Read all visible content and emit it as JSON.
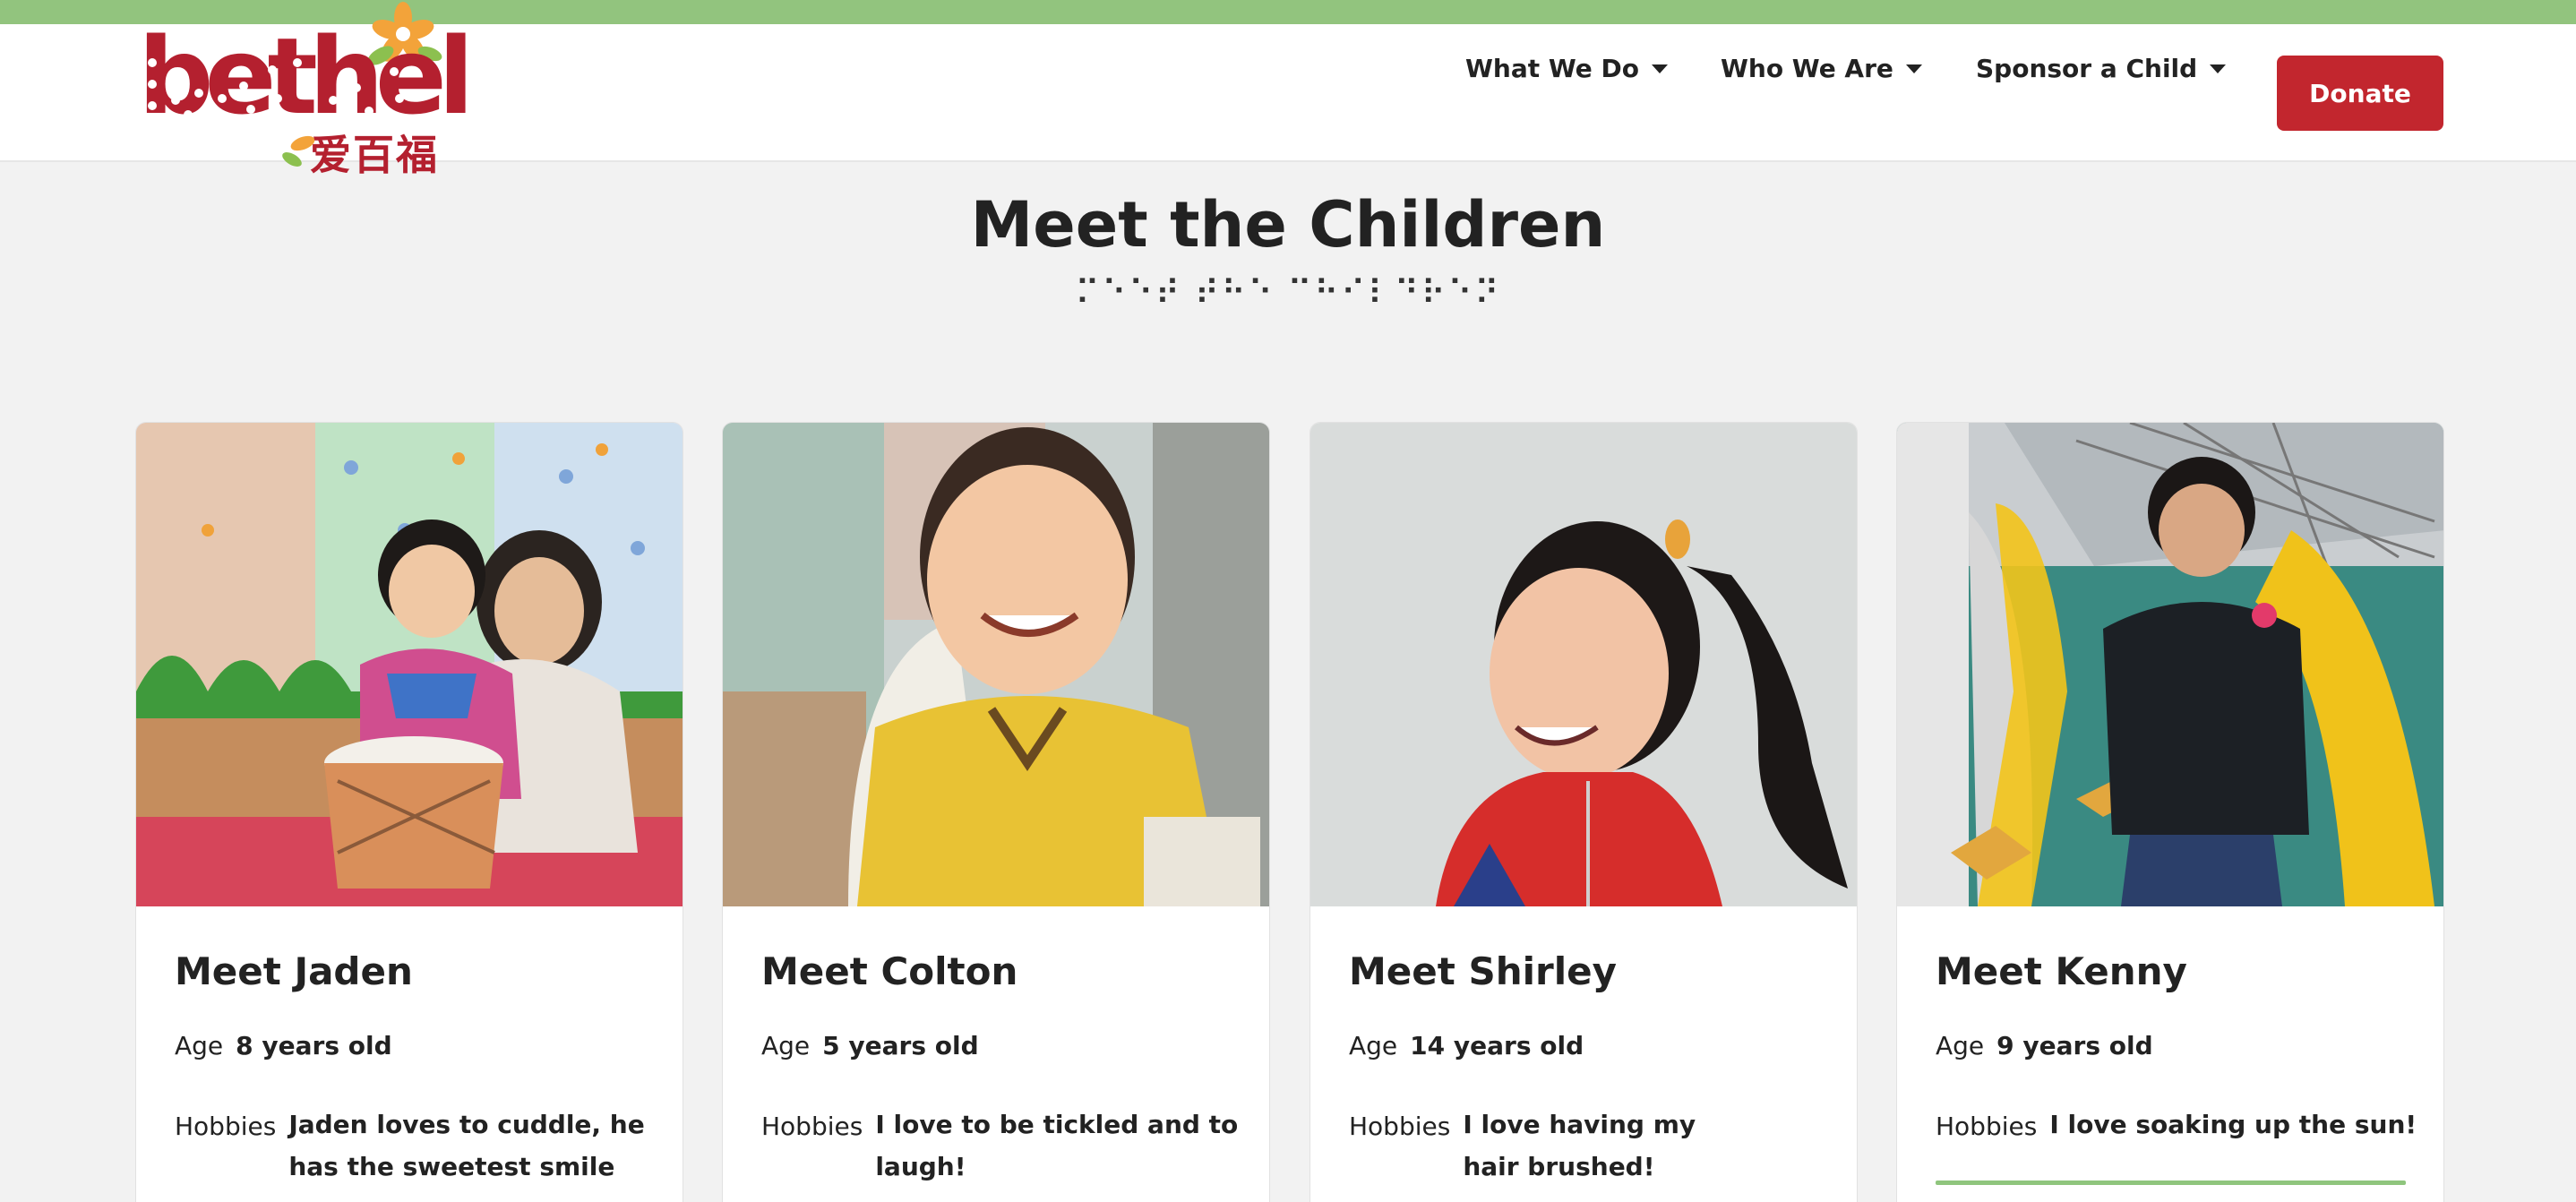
{
  "brand": {
    "logo_text": "bethel",
    "logo_cn": "爱百福"
  },
  "nav": {
    "items": [
      {
        "label": "What We Do"
      },
      {
        "label": "Who We Are"
      },
      {
        "label": "Sponsor a Child"
      }
    ],
    "donate_label": "Donate"
  },
  "page": {
    "title": "Meet the Children",
    "braille": "⠍⠑⠑⠞ ⠞⠓⠑ ⠉⠓⠊⠇⠙⠗⠑⠝"
  },
  "cards": [
    {
      "title": "Meet Jaden",
      "age_label": "Age",
      "age": "8 years old",
      "hobbies_label": "Hobbies",
      "hobbies": "Jaden loves to cuddle, he has the sweetest smile"
    },
    {
      "title": "Meet Colton",
      "age_label": "Age",
      "age": "5 years old",
      "hobbies_label": "Hobbies",
      "hobbies": "I love to be tickled and to laugh!"
    },
    {
      "title": "Meet Shirley",
      "age_label": "Age",
      "age": "14 years old",
      "hobbies_label": "Hobbies",
      "hobbies": "I love having my hair brushed!"
    },
    {
      "title": "Meet Kenny",
      "age_label": "Age",
      "age": "9 years old",
      "hobbies_label": "Hobbies",
      "hobbies": "I love soaking up the sun!"
    }
  ],
  "colors": {
    "accent_green": "#92c47e",
    "brand_red": "#c2262e"
  }
}
